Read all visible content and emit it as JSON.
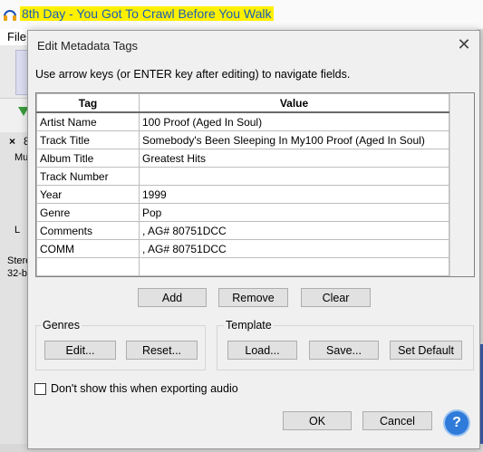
{
  "app": {
    "title": "8th Day - You Got To Crawl Before You Walk",
    "menu_file": "File",
    "track_close": "×",
    "track_name": "8",
    "track_mute": "Mu",
    "track_l": "L",
    "track_format1": "Stere",
    "track_format2": "32-b",
    "accent": "#fff000"
  },
  "dialog": {
    "title": "Edit Metadata Tags",
    "close_glyph": "✕",
    "instructions": "Use arrow keys (or ENTER key after editing) to navigate fields.",
    "columns": {
      "tag": "Tag",
      "value": "Value"
    },
    "rows": [
      {
        "tag": "Artist Name",
        "value": "100 Proof (Aged In Soul)"
      },
      {
        "tag": "Track Title",
        "value": "Somebody's Been Sleeping In My100 Proof (Aged In Soul)"
      },
      {
        "tag": "Album Title",
        "value": "Greatest Hits"
      },
      {
        "tag": "Track Number",
        "value": ""
      },
      {
        "tag": "Year",
        "value": "1999"
      },
      {
        "tag": "Genre",
        "value": "Pop"
      },
      {
        "tag": "Comments",
        "value": ", AG# 80751DCC"
      },
      {
        "tag": "COMM",
        "value": ", AG# 80751DCC"
      },
      {
        "tag": "",
        "value": ""
      }
    ],
    "buttons": {
      "add": "Add",
      "remove": "Remove",
      "clear": "Clear",
      "genres_edit": "Edit...",
      "genres_reset": "Reset...",
      "template_load": "Load...",
      "template_save": "Save...",
      "template_default": "Set Default",
      "ok": "OK",
      "cancel": "Cancel",
      "help": "?"
    },
    "groups": {
      "genres": "Genres",
      "template": "Template"
    },
    "checkbox_label": "Don't show this when exporting audio",
    "checkbox_checked": false
  }
}
